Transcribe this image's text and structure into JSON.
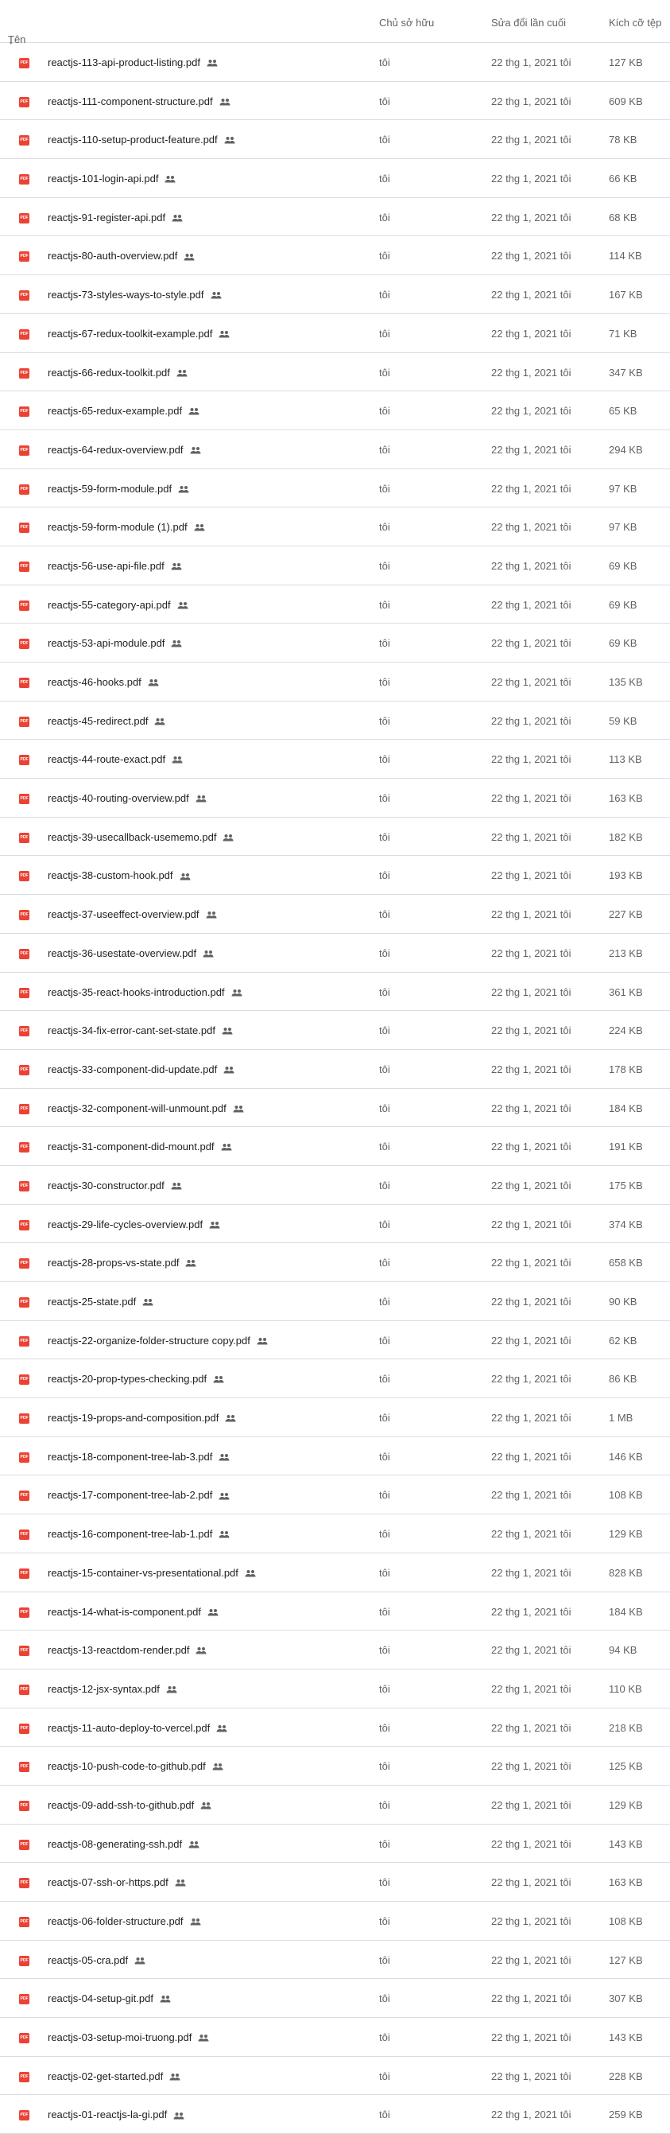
{
  "header": {
    "name_label": "Tên",
    "sort_icon": "arrow-down-icon",
    "owner_label": "Chủ sở hữu",
    "modified_label": "Sửa đổi lần cuối",
    "size_label": "Kích cỡ tệp"
  },
  "colors": {
    "pdf_icon": "#ea4335",
    "divider": "#dadce0"
  },
  "files": [
    {
      "name": "reactjs-113-api-product-listing.pdf",
      "owner": "tôi",
      "modified": "22 thg 1, 2021  tôi",
      "size": "127 KB"
    },
    {
      "name": "reactjs-111-component-structure.pdf",
      "owner": "tôi",
      "modified": "22 thg 1, 2021  tôi",
      "size": "609 KB"
    },
    {
      "name": "reactjs-110-setup-product-feature.pdf",
      "owner": "tôi",
      "modified": "22 thg 1, 2021  tôi",
      "size": "78 KB"
    },
    {
      "name": "reactjs-101-login-api.pdf",
      "owner": "tôi",
      "modified": "22 thg 1, 2021  tôi",
      "size": "66 KB"
    },
    {
      "name": "reactjs-91-register-api.pdf",
      "owner": "tôi",
      "modified": "22 thg 1, 2021  tôi",
      "size": "68 KB"
    },
    {
      "name": "reactjs-80-auth-overview.pdf",
      "owner": "tôi",
      "modified": "22 thg 1, 2021  tôi",
      "size": "114 KB"
    },
    {
      "name": "reactjs-73-styles-ways-to-style.pdf",
      "owner": "tôi",
      "modified": "22 thg 1, 2021  tôi",
      "size": "167 KB"
    },
    {
      "name": "reactjs-67-redux-toolkit-example.pdf",
      "owner": "tôi",
      "modified": "22 thg 1, 2021  tôi",
      "size": "71 KB"
    },
    {
      "name": "reactjs-66-redux-toolkit.pdf",
      "owner": "tôi",
      "modified": "22 thg 1, 2021  tôi",
      "size": "347 KB"
    },
    {
      "name": "reactjs-65-redux-example.pdf",
      "owner": "tôi",
      "modified": "22 thg 1, 2021  tôi",
      "size": "65 KB"
    },
    {
      "name": "reactjs-64-redux-overview.pdf",
      "owner": "tôi",
      "modified": "22 thg 1, 2021  tôi",
      "size": "294 KB"
    },
    {
      "name": "reactjs-59-form-module.pdf",
      "owner": "tôi",
      "modified": "22 thg 1, 2021  tôi",
      "size": "97 KB"
    },
    {
      "name": "reactjs-59-form-module (1).pdf",
      "owner": "tôi",
      "modified": "22 thg 1, 2021  tôi",
      "size": "97 KB"
    },
    {
      "name": "reactjs-56-use-api-file.pdf",
      "owner": "tôi",
      "modified": "22 thg 1, 2021  tôi",
      "size": "69 KB"
    },
    {
      "name": "reactjs-55-category-api.pdf",
      "owner": "tôi",
      "modified": "22 thg 1, 2021  tôi",
      "size": "69 KB"
    },
    {
      "name": "reactjs-53-api-module.pdf",
      "owner": "tôi",
      "modified": "22 thg 1, 2021  tôi",
      "size": "69 KB"
    },
    {
      "name": "reactjs-46-hooks.pdf",
      "owner": "tôi",
      "modified": "22 thg 1, 2021  tôi",
      "size": "135 KB"
    },
    {
      "name": "reactjs-45-redirect.pdf",
      "owner": "tôi",
      "modified": "22 thg 1, 2021  tôi",
      "size": "59 KB"
    },
    {
      "name": "reactjs-44-route-exact.pdf",
      "owner": "tôi",
      "modified": "22 thg 1, 2021  tôi",
      "size": "113 KB"
    },
    {
      "name": "reactjs-40-routing-overview.pdf",
      "owner": "tôi",
      "modified": "22 thg 1, 2021  tôi",
      "size": "163 KB"
    },
    {
      "name": "reactjs-39-usecallback-usememo.pdf",
      "owner": "tôi",
      "modified": "22 thg 1, 2021  tôi",
      "size": "182 KB"
    },
    {
      "name": "reactjs-38-custom-hook.pdf",
      "owner": "tôi",
      "modified": "22 thg 1, 2021  tôi",
      "size": "193 KB"
    },
    {
      "name": "reactjs-37-useeffect-overview.pdf",
      "owner": "tôi",
      "modified": "22 thg 1, 2021  tôi",
      "size": "227 KB"
    },
    {
      "name": "reactjs-36-usestate-overview.pdf",
      "owner": "tôi",
      "modified": "22 thg 1, 2021  tôi",
      "size": "213 KB"
    },
    {
      "name": "reactjs-35-react-hooks-introduction.pdf",
      "owner": "tôi",
      "modified": "22 thg 1, 2021  tôi",
      "size": "361 KB"
    },
    {
      "name": "reactjs-34-fix-error-cant-set-state.pdf",
      "owner": "tôi",
      "modified": "22 thg 1, 2021  tôi",
      "size": "224 KB"
    },
    {
      "name": "reactjs-33-component-did-update.pdf",
      "owner": "tôi",
      "modified": "22 thg 1, 2021  tôi",
      "size": "178 KB"
    },
    {
      "name": "reactjs-32-component-will-unmount.pdf",
      "owner": "tôi",
      "modified": "22 thg 1, 2021  tôi",
      "size": "184 KB"
    },
    {
      "name": "reactjs-31-component-did-mount.pdf",
      "owner": "tôi",
      "modified": "22 thg 1, 2021  tôi",
      "size": "191 KB"
    },
    {
      "name": "reactjs-30-constructor.pdf",
      "owner": "tôi",
      "modified": "22 thg 1, 2021  tôi",
      "size": "175 KB"
    },
    {
      "name": "reactjs-29-life-cycles-overview.pdf",
      "owner": "tôi",
      "modified": "22 thg 1, 2021  tôi",
      "size": "374 KB"
    },
    {
      "name": "reactjs-28-props-vs-state.pdf",
      "owner": "tôi",
      "modified": "22 thg 1, 2021  tôi",
      "size": "658 KB"
    },
    {
      "name": "reactjs-25-state.pdf",
      "owner": "tôi",
      "modified": "22 thg 1, 2021  tôi",
      "size": "90 KB"
    },
    {
      "name": "reactjs-22-organize-folder-structure copy.pdf",
      "owner": "tôi",
      "modified": "22 thg 1, 2021  tôi",
      "size": "62 KB"
    },
    {
      "name": "reactjs-20-prop-types-checking.pdf",
      "owner": "tôi",
      "modified": "22 thg 1, 2021  tôi",
      "size": "86 KB"
    },
    {
      "name": "reactjs-19-props-and-composition.pdf",
      "owner": "tôi",
      "modified": "22 thg 1, 2021  tôi",
      "size": "1 MB"
    },
    {
      "name": "reactjs-18-component-tree-lab-3.pdf",
      "owner": "tôi",
      "modified": "22 thg 1, 2021  tôi",
      "size": "146 KB"
    },
    {
      "name": "reactjs-17-component-tree-lab-2.pdf",
      "owner": "tôi",
      "modified": "22 thg 1, 2021  tôi",
      "size": "108 KB"
    },
    {
      "name": "reactjs-16-component-tree-lab-1.pdf",
      "owner": "tôi",
      "modified": "22 thg 1, 2021  tôi",
      "size": "129 KB"
    },
    {
      "name": "reactjs-15-container-vs-presentational.pdf",
      "owner": "tôi",
      "modified": "22 thg 1, 2021  tôi",
      "size": "828 KB"
    },
    {
      "name": "reactjs-14-what-is-component.pdf",
      "owner": "tôi",
      "modified": "22 thg 1, 2021  tôi",
      "size": "184 KB"
    },
    {
      "name": "reactjs-13-reactdom-render.pdf",
      "owner": "tôi",
      "modified": "22 thg 1, 2021  tôi",
      "size": "94 KB"
    },
    {
      "name": "reactjs-12-jsx-syntax.pdf",
      "owner": "tôi",
      "modified": "22 thg 1, 2021  tôi",
      "size": "110 KB"
    },
    {
      "name": "reactjs-11-auto-deploy-to-vercel.pdf",
      "owner": "tôi",
      "modified": "22 thg 1, 2021  tôi",
      "size": "218 KB"
    },
    {
      "name": "reactjs-10-push-code-to-github.pdf",
      "owner": "tôi",
      "modified": "22 thg 1, 2021  tôi",
      "size": "125 KB"
    },
    {
      "name": "reactjs-09-add-ssh-to-github.pdf",
      "owner": "tôi",
      "modified": "22 thg 1, 2021  tôi",
      "size": "129 KB"
    },
    {
      "name": "reactjs-08-generating-ssh.pdf",
      "owner": "tôi",
      "modified": "22 thg 1, 2021  tôi",
      "size": "143 KB"
    },
    {
      "name": "reactjs-07-ssh-or-https.pdf",
      "owner": "tôi",
      "modified": "22 thg 1, 2021  tôi",
      "size": "163 KB"
    },
    {
      "name": "reactjs-06-folder-structure.pdf",
      "owner": "tôi",
      "modified": "22 thg 1, 2021  tôi",
      "size": "108 KB"
    },
    {
      "name": "reactjs-05-cra.pdf",
      "owner": "tôi",
      "modified": "22 thg 1, 2021  tôi",
      "size": "127 KB"
    },
    {
      "name": "reactjs-04-setup-git.pdf",
      "owner": "tôi",
      "modified": "22 thg 1, 2021  tôi",
      "size": "307 KB"
    },
    {
      "name": "reactjs-03-setup-moi-truong.pdf",
      "owner": "tôi",
      "modified": "22 thg 1, 2021  tôi",
      "size": "143 KB"
    },
    {
      "name": "reactjs-02-get-started.pdf",
      "owner": "tôi",
      "modified": "22 thg 1, 2021  tôi",
      "size": "228 KB"
    },
    {
      "name": "reactjs-01-reactjs-la-gi.pdf",
      "owner": "tôi",
      "modified": "22 thg 1, 2021  tôi",
      "size": "259 KB"
    }
  ]
}
